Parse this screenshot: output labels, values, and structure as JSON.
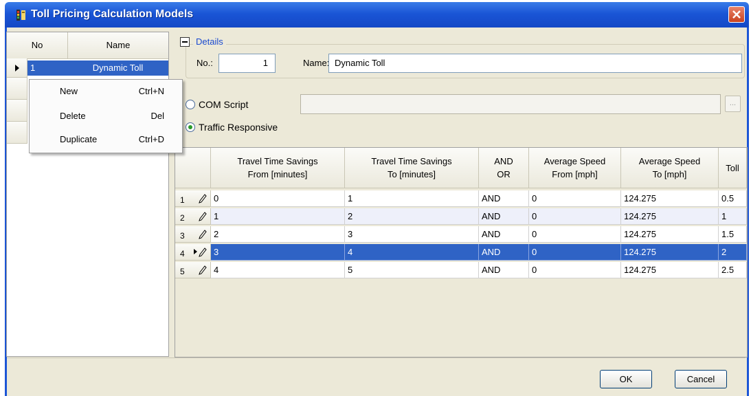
{
  "window": {
    "title": "Toll Pricing Calculation Models"
  },
  "left_list": {
    "headers": {
      "no": "No",
      "name": "Name"
    },
    "rows": [
      {
        "no": "1",
        "name": "Dynamic Toll"
      }
    ]
  },
  "context_menu": {
    "items": [
      {
        "label": "New",
        "shortcut": "Ctrl+N"
      },
      {
        "label": "Delete",
        "shortcut": "Del"
      },
      {
        "label": "Duplicate",
        "shortcut": "Ctrl+D"
      }
    ]
  },
  "details": {
    "group_title": "Details",
    "no_label": "No.:",
    "no_value": "1",
    "name_label": "Name:",
    "name_value": "Dynamic Toll",
    "com_script_label": "COM Script",
    "com_script_value": "",
    "browse_label": "...",
    "traffic_responsive_label": "Traffic Responsive",
    "selected_option": "Traffic Responsive"
  },
  "grid": {
    "headers": {
      "tts_from": "Travel Time Savings\nFrom [minutes]",
      "tts_to": "Travel Time Savings\nTo [minutes]",
      "and_or": "AND\nOR",
      "speed_from": "Average Speed\nFrom [mph]",
      "speed_to": "Average Speed\nTo [mph]",
      "toll": "Toll"
    },
    "rows": [
      {
        "n": "1",
        "tts_from": "0",
        "tts_to": "1",
        "and_or": "AND",
        "speed_from": "0",
        "speed_to": "124.275",
        "toll": "0.5"
      },
      {
        "n": "2",
        "tts_from": "1",
        "tts_to": "2",
        "and_or": "AND",
        "speed_from": "0",
        "speed_to": "124.275",
        "toll": "1"
      },
      {
        "n": "3",
        "tts_from": "2",
        "tts_to": "3",
        "and_or": "AND",
        "speed_from": "0",
        "speed_to": "124.275",
        "toll": "1.5"
      },
      {
        "n": "4",
        "tts_from": "3",
        "tts_to": "4",
        "and_or": "AND",
        "speed_from": "0",
        "speed_to": "124.275",
        "toll": "2"
      },
      {
        "n": "5",
        "tts_from": "4",
        "tts_to": "5",
        "and_or": "AND",
        "speed_from": "0",
        "speed_to": "124.275",
        "toll": "2.5"
      }
    ]
  },
  "buttons": {
    "ok": "OK",
    "cancel": "Cancel"
  },
  "colors": {
    "titlebar": "#1a55d6",
    "selection": "#2f63c5",
    "dialog_bg": "#ece9d8",
    "group_title": "#1a4ad0"
  }
}
